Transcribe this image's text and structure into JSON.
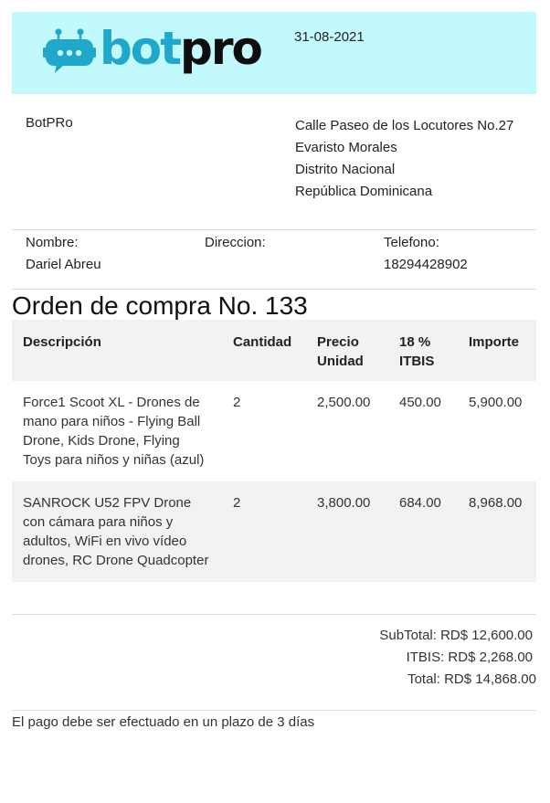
{
  "header": {
    "logo": {
      "part1": "bot",
      "part2": "pro",
      "icon": "robot-chat-icon"
    },
    "date": "31-08-2021"
  },
  "company": {
    "name": "BotPRo",
    "address": [
      "Calle Paseo de los Locutores No.27",
      "Evaristo Morales",
      "Distrito Nacional",
      "República Dominicana"
    ]
  },
  "client": {
    "name_label": "Nombre:",
    "name": "Dariel Abreu",
    "address_label": "Direccion:",
    "address": "",
    "phone_label": "Telefono:",
    "phone": "18294428902"
  },
  "order": {
    "title": "Orden de compra No. 133",
    "columns": [
      "Descripción",
      "Cantidad",
      "Precio Unidad",
      "18 % ITBIS",
      "Importe"
    ],
    "items": [
      {
        "description": "Force1 Scoot XL - Drones de mano para niños - Flying Ball Drone, Kids Drone, Flying Toys para niños y niñas (azul)",
        "quantity": "2",
        "unit_price": "2,500.00",
        "itbis": "450.00",
        "amount": "5,900.00"
      },
      {
        "description": "SANROCK U52 FPV Drone con cámara para niños y adultos, WiFi en vivo vídeo drones, RC Drone Quadcopter",
        "quantity": "2",
        "unit_price": "3,800.00",
        "itbis": "684.00",
        "amount": "8,968.00"
      }
    ]
  },
  "totals": {
    "subtotal": "SubTotal: RD$ 12,600.00",
    "itbis": "ITBIS: RD$ 2,268.00",
    "total": "Total: RD$ 14,868.00"
  },
  "footer": {
    "note": "El pago debe ser efectuado en un plazo de 3 días"
  },
  "colors": {
    "header_bg": "#c2f9fd",
    "logo_blue": "#21a7c9",
    "logo_dark": "#0e0e0e",
    "row_stripe": "#f2f2f2"
  }
}
